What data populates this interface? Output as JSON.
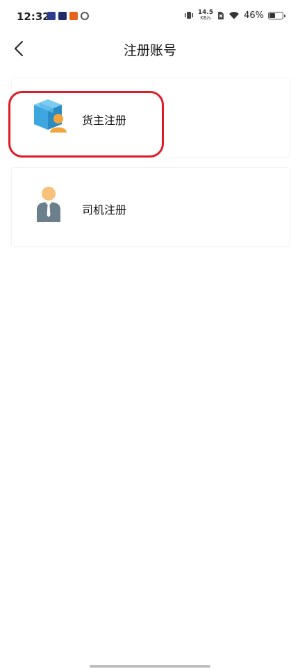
{
  "status_bar": {
    "time": "12:32",
    "net_speed_value": "14.5",
    "net_speed_unit": "KB/s",
    "battery_percent": "46%",
    "battery_level": 0.46
  },
  "header": {
    "title": "注册账号",
    "back_icon": "chevron-left-icon"
  },
  "options": [
    {
      "label": "货主注册",
      "icon": "shipper-box-person-icon"
    },
    {
      "label": "司机注册",
      "icon": "driver-person-icon"
    }
  ],
  "colors": {
    "highlight": "#e01b24",
    "box_blue": "#3ea7e0",
    "person_orange": "#f2a53a",
    "driver_gray": "#6b7f8c"
  }
}
